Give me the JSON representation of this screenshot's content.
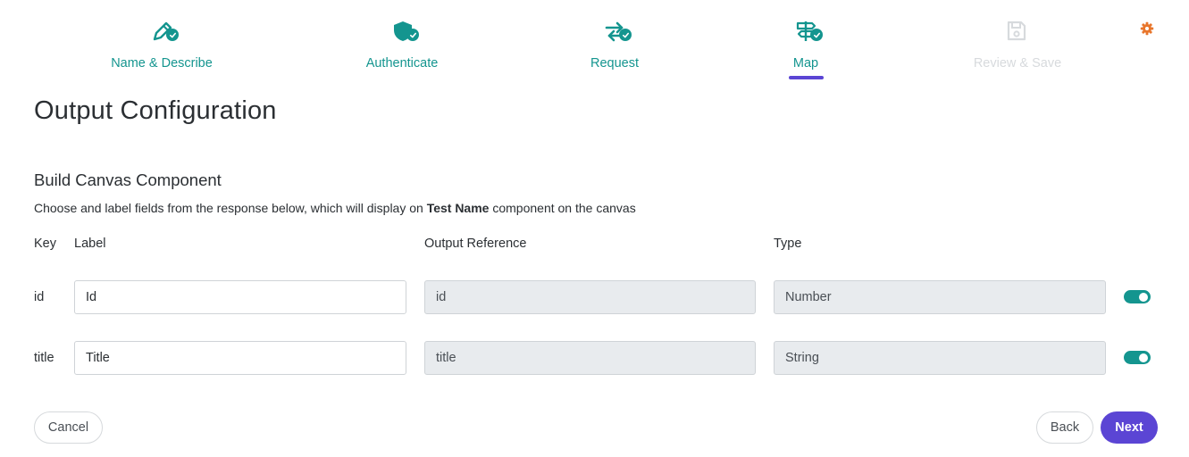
{
  "stepper": {
    "steps": [
      {
        "label": "Name & Describe",
        "icon": "pencil-icon",
        "status": "complete"
      },
      {
        "label": "Authenticate",
        "icon": "shield-icon",
        "status": "complete"
      },
      {
        "label": "Request",
        "icon": "arrows-exchange-icon",
        "status": "complete"
      },
      {
        "label": "Map",
        "icon": "signpost-icon",
        "status": "active"
      },
      {
        "label": "Review & Save",
        "icon": "save-icon",
        "status": "disabled"
      }
    ]
  },
  "colors": {
    "accent": "#14958f",
    "primary": "#5b45d4",
    "gear": "#e8762c",
    "disabled": "#d7dadd"
  },
  "page": {
    "title": "Output Configuration"
  },
  "section": {
    "title": "Build Canvas Component",
    "desc_before": "Choose and label fields from the response below, which will display on ",
    "desc_bold": "Test Name",
    "desc_after": " component on the canvas"
  },
  "table": {
    "headers": {
      "key": "Key",
      "label": "Label",
      "reference": "Output Reference",
      "type": "Type"
    },
    "rows": [
      {
        "key": "id",
        "label": "Id",
        "reference": "id",
        "type": "Number",
        "enabled": true
      },
      {
        "key": "title",
        "label": "Title",
        "reference": "title",
        "type": "String",
        "enabled": true
      }
    ]
  },
  "buttons": {
    "cancel": "Cancel",
    "back": "Back",
    "next": "Next"
  }
}
